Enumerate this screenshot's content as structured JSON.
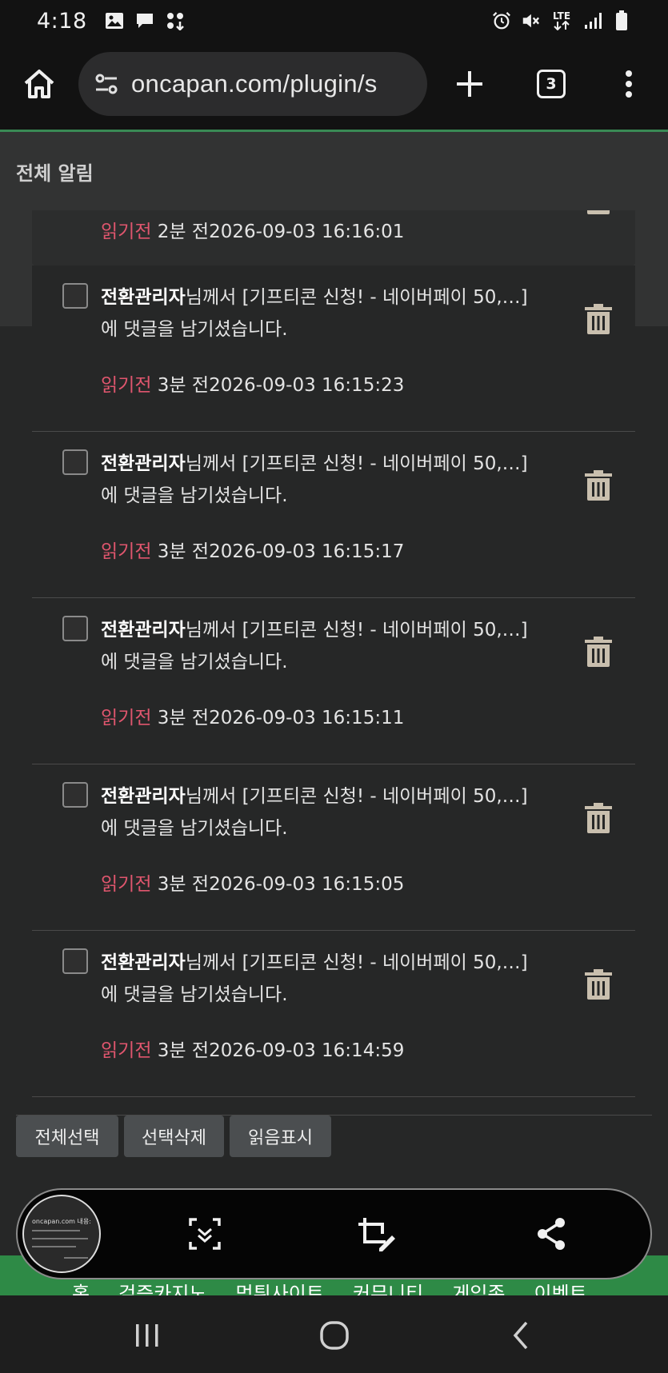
{
  "status_bar": {
    "time": "4:18",
    "left_icons": [
      "gallery-icon",
      "chat-icon",
      "apps-icon"
    ],
    "right_icons": [
      "alarm-icon",
      "mute-icon",
      "lte-icon",
      "signal-icon",
      "battery-icon"
    ],
    "network": "LTE"
  },
  "browser": {
    "url": "oncapan.com/plugin/s",
    "tab_count": "3"
  },
  "page": {
    "title": "전체 알림"
  },
  "notifications": {
    "partial": {
      "read_status": "읽기전",
      "relative_time": "2분 전",
      "timestamp": "2026-09-03 16:16:01"
    },
    "items": [
      {
        "author": "전환관리자",
        "message_suffix": "님께서 [기프티콘 신청! - 네이버페이 50,…] 에 댓글을 남기셨습니다.",
        "read_status": "읽기전",
        "relative_time": "3분 전",
        "timestamp": "2026-09-03 16:15:23"
      },
      {
        "author": "전환관리자",
        "message_suffix": "님께서 [기프티콘 신청! - 네이버페이 50,…] 에 댓글을 남기셨습니다.",
        "read_status": "읽기전",
        "relative_time": "3분 전",
        "timestamp": "2026-09-03 16:15:17"
      },
      {
        "author": "전환관리자",
        "message_suffix": "님께서 [기프티콘 신청! - 네이버페이 50,…] 에 댓글을 남기셨습니다.",
        "read_status": "읽기전",
        "relative_time": "3분 전",
        "timestamp": "2026-09-03 16:15:11"
      },
      {
        "author": "전환관리자",
        "message_suffix": "님께서 [기프티콘 신청! - 네이버페이 50,…] 에 댓글을 남기셨습니다.",
        "read_status": "읽기전",
        "relative_time": "3분 전",
        "timestamp": "2026-09-03 16:15:05"
      },
      {
        "author": "전환관리자",
        "message_suffix": "님께서 [기프티콘 신청! - 네이버페이 50,…] 에 댓글을 남기셨습니다.",
        "read_status": "읽기전",
        "relative_time": "3분 전",
        "timestamp": "2026-09-03 16:14:59"
      }
    ]
  },
  "actions": {
    "select_all": "전체선택",
    "delete_selected": "선택삭제",
    "mark_read": "읽음표시"
  },
  "footer_nav": {
    "items": [
      "홈",
      "검증카지노",
      "먹튀사이트",
      "커뮤니티",
      "게임존",
      "이벤트"
    ]
  },
  "screenshot_toolbar": {
    "thumbnail_title": "oncapan.com 내용:",
    "buttons": [
      "scroll-capture-icon",
      "crop-edit-icon",
      "share-icon"
    ]
  },
  "nav_bar": {
    "buttons": [
      "recents-icon",
      "home-icon",
      "back-icon"
    ]
  },
  "colors": {
    "unread": "#e0566e",
    "accent_green": "#2e8a46",
    "background": "#262727"
  }
}
